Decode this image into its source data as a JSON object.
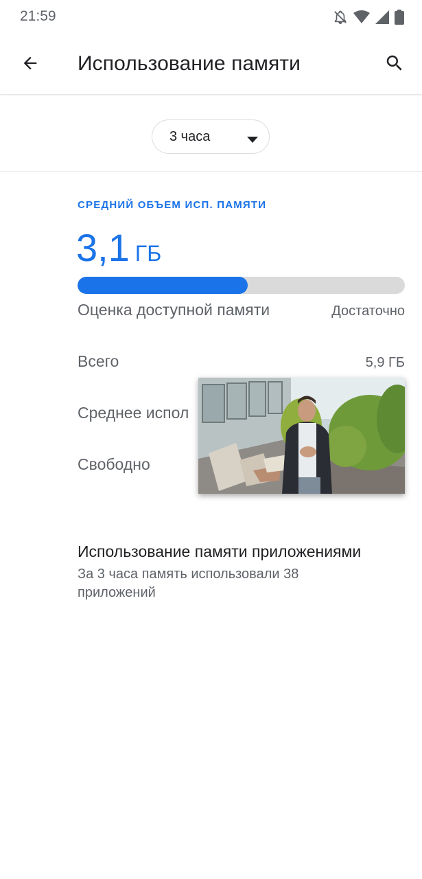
{
  "status_bar": {
    "time": "21:59",
    "icons": [
      "notifications-off-icon",
      "wifi-icon",
      "signal-icon",
      "battery-icon"
    ]
  },
  "app_bar": {
    "title": "Использование памяти",
    "back_icon": "arrow-back-icon",
    "search_icon": "search-icon"
  },
  "period": {
    "selected": "3 часа",
    "arrow_icon": "dropdown-arrow-icon"
  },
  "memory": {
    "section_label": "СРЕДНИЙ ОБЪЕМ ИСП. ПАМЯТИ",
    "average_number": "3,1",
    "average_unit": "ГБ",
    "usage_fraction": 0.52,
    "rows": [
      {
        "label": "Оценка доступной памяти",
        "value": "Достаточно"
      },
      {
        "label": "Всего",
        "value": "5,9 ГБ"
      },
      {
        "label": "Среднее испол",
        "value": ""
      },
      {
        "label": "Свободно",
        "value": ""
      }
    ]
  },
  "apps": {
    "title": "Использование памяти приложениями",
    "subtitle": "За 3 часа память использовали 38 приложений"
  },
  "colors": {
    "accent": "#1a73e8",
    "track": "#dadada",
    "text_primary": "#202124",
    "text_secondary": "#5f6368"
  }
}
